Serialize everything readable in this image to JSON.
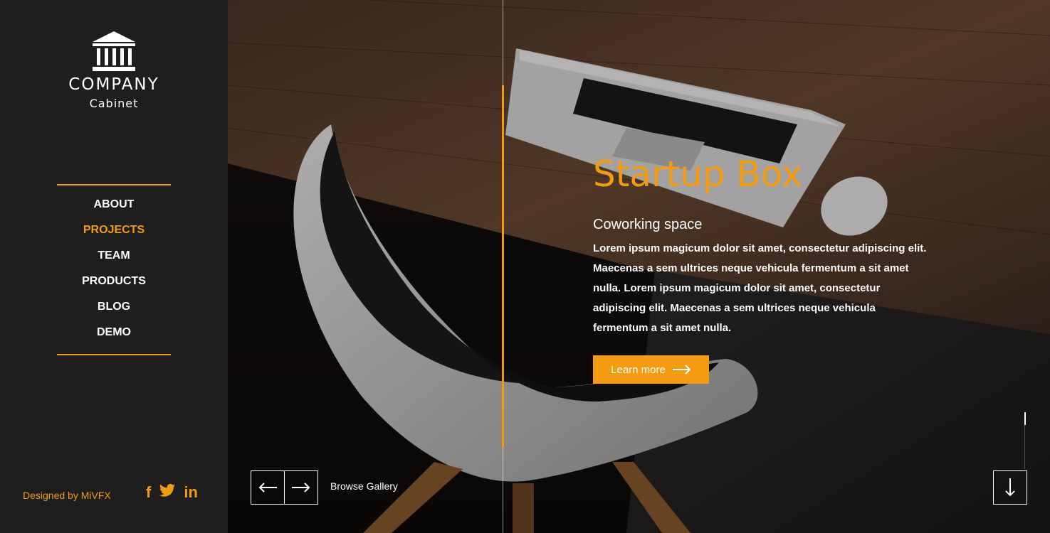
{
  "brand": {
    "name": "COMPANY",
    "tagline": "Cabinet",
    "logo_icon": "bank-building-icon"
  },
  "nav": {
    "items": [
      {
        "label": "ABOUT"
      },
      {
        "label": "PROJECTS",
        "active": true
      },
      {
        "label": "TEAM"
      },
      {
        "label": "PRODUCTS"
      },
      {
        "label": "BLOG"
      },
      {
        "label": "DEMO"
      }
    ]
  },
  "footer": {
    "credit": "Designed by MiVFX",
    "social": [
      {
        "icon": "facebook-icon",
        "glyph": "f"
      },
      {
        "icon": "twitter-icon",
        "glyph": "t"
      },
      {
        "icon": "linkedin-icon",
        "glyph": "in"
      }
    ]
  },
  "slide": {
    "title": "Startup Box",
    "subtitle": "Coworking space",
    "body": "Lorem ipsum magicum dolor sit amet, consectetur adipiscing elit. Maecenas a sem ultrices neque vehicula fermentum a sit amet nulla. Lorem ipsum magicum dolor sit amet, consectetur adipiscing elit. Maecenas a sem ultrices neque vehicula fermentum a sit amet nulla.",
    "button_label": "Learn more"
  },
  "gallery": {
    "browse_label": "Browse Gallery"
  },
  "colors": {
    "accent": "#f39c12",
    "sidebar": "#1e1e1f"
  }
}
